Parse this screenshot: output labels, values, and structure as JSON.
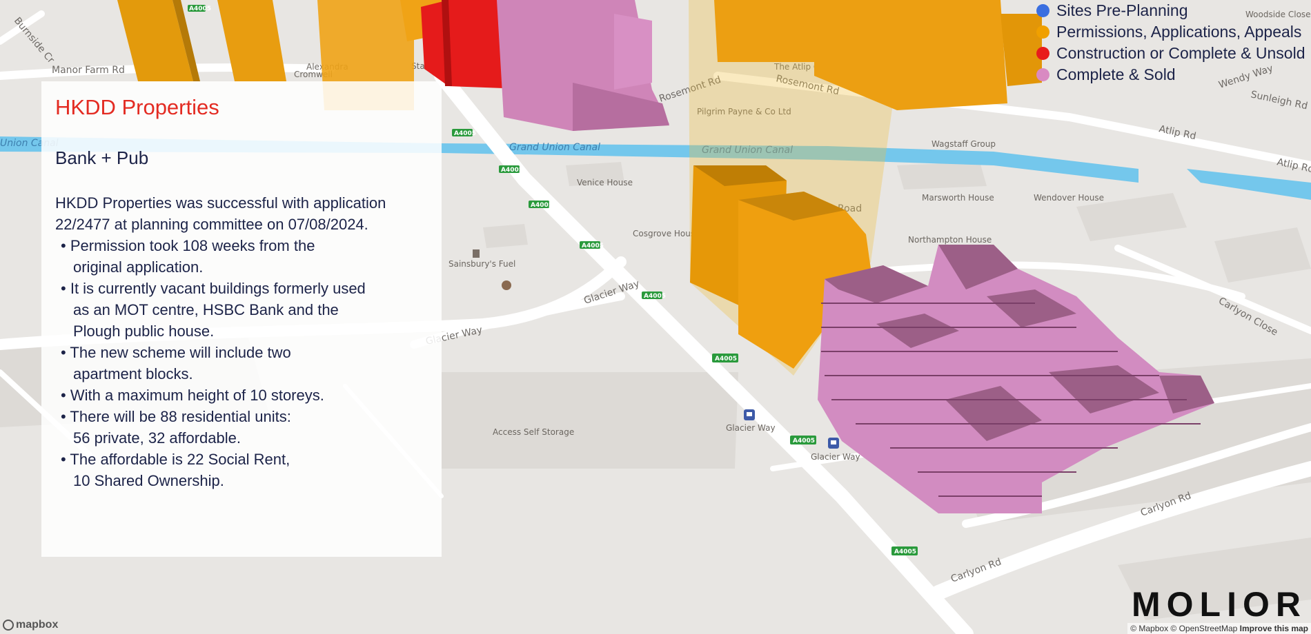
{
  "panel": {
    "title": "HKDD Properties",
    "subtitle": "Bank + Pub",
    "intro_1": "HKDD Properties was successful with application",
    "intro_2": "22/2477 at planning committee on 07/08/2024.",
    "bullets": [
      [
        "Permission took 108 weeks from the",
        "original application."
      ],
      [
        "It is currently vacant buildings formerly used",
        "as an MOT centre, HSBC Bank and the",
        "Plough public house."
      ],
      [
        "The new scheme will include two",
        "apartment blocks."
      ],
      [
        "With a maximum height of 10 storeys."
      ],
      [
        "There will be 88 residential units:",
        "56 private, 32 affordable."
      ],
      [
        "The affordable is 22 Social Rent,",
        "10 Shared Ownership."
      ]
    ]
  },
  "legend": {
    "items": [
      {
        "label": "Sites Pre-Planning",
        "color": "#3b6fe0"
      },
      {
        "label": "Permissions, Applications, Appeals",
        "color": "#f0a000"
      },
      {
        "label": "Construction or Complete & Unsold",
        "color": "#e81c1c"
      },
      {
        "label": "Complete & Sold",
        "color": "#d98ac2"
      }
    ]
  },
  "map": {
    "place_labels": {
      "venice": "Venice House",
      "cosgrove": "Cosgrove House",
      "sainsbury": "Sainsbury's Fuel",
      "marsworth": "Marsworth House",
      "wendover": "Wendover House",
      "northampton": "Northampton House",
      "wagstaff": "Wagstaff Group",
      "pilgrim": "Pilgrim Payne & Co Ltd",
      "atlip_centre": "The Atlip Centre",
      "access": "Access Self Storage",
      "glacier_stop1": "Glacier Way",
      "glacier_stop2": "Glacier Way",
      "woodside": "Woodside Close",
      "station": "Station",
      "alexandra": "Alexandra",
      "cromwell": "Cromwell"
    },
    "road_labels": {
      "manor_farm": "Manor Farm Rd",
      "burnside": "Burnside Cr",
      "rosemont1": "Rosemont Rd",
      "rosemont2": "Rosemont Rd",
      "atlip1": "Atlip Rd",
      "atlip2": "Atlip Rd",
      "wendy": "Wendy Way",
      "sunleigh": "Sunleigh Rd",
      "glacier1": "Glacier Way",
      "glacier2": "Glacier Way",
      "carlyon_close": "Carlyon Close",
      "carlyon1": "Carlyon Rd",
      "carlyon2": "Carlyon Rd",
      "road": "Road"
    },
    "canal_labels": {
      "c1": "Grand Union Canal",
      "c2": "Grand Union Canal",
      "c3": "Union Canal"
    },
    "road_shield": "A4005"
  },
  "branding": {
    "logo": "MOLIOR",
    "mapbox": "mapbox",
    "attribution": "© Mapbox © OpenStreetMap",
    "improve": "Improve this map"
  }
}
